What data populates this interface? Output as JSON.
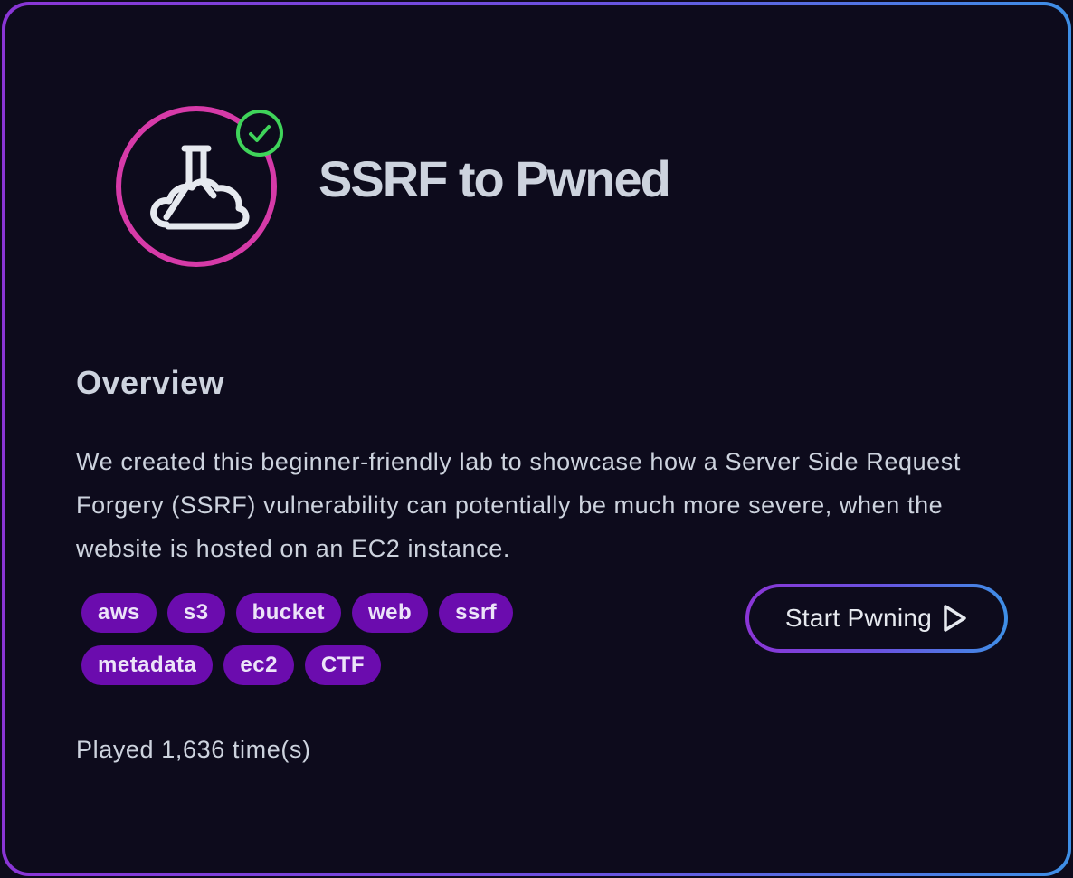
{
  "lab": {
    "title": "SSRF to Pwned",
    "icon": "flask-cloud-icon",
    "completed_icon": "checkmark-circle-icon"
  },
  "overview": {
    "heading": "Overview",
    "description": "We created this beginner-friendly lab to showcase how a Server Side Request Forgery (SSRF) vulnerability can potentially be much more severe, when the website is hosted on an EC2 instance."
  },
  "tags": [
    "aws",
    "s3",
    "bucket",
    "web",
    "ssrf",
    "metadata",
    "ec2",
    "CTF"
  ],
  "start_button": {
    "label": "Start Pwning",
    "icon": "play-icon"
  },
  "stats": {
    "played_text": "Played 1,636 time(s)"
  },
  "colors": {
    "background": "#0d0b1c",
    "icon_ring": "#d63aa8",
    "check_green": "#3fd45a",
    "tag_purple": "#6b0cae",
    "border_gradient_start": "#8a35d6",
    "border_gradient_end": "#3e8fe6",
    "text": "#cdd3de"
  }
}
